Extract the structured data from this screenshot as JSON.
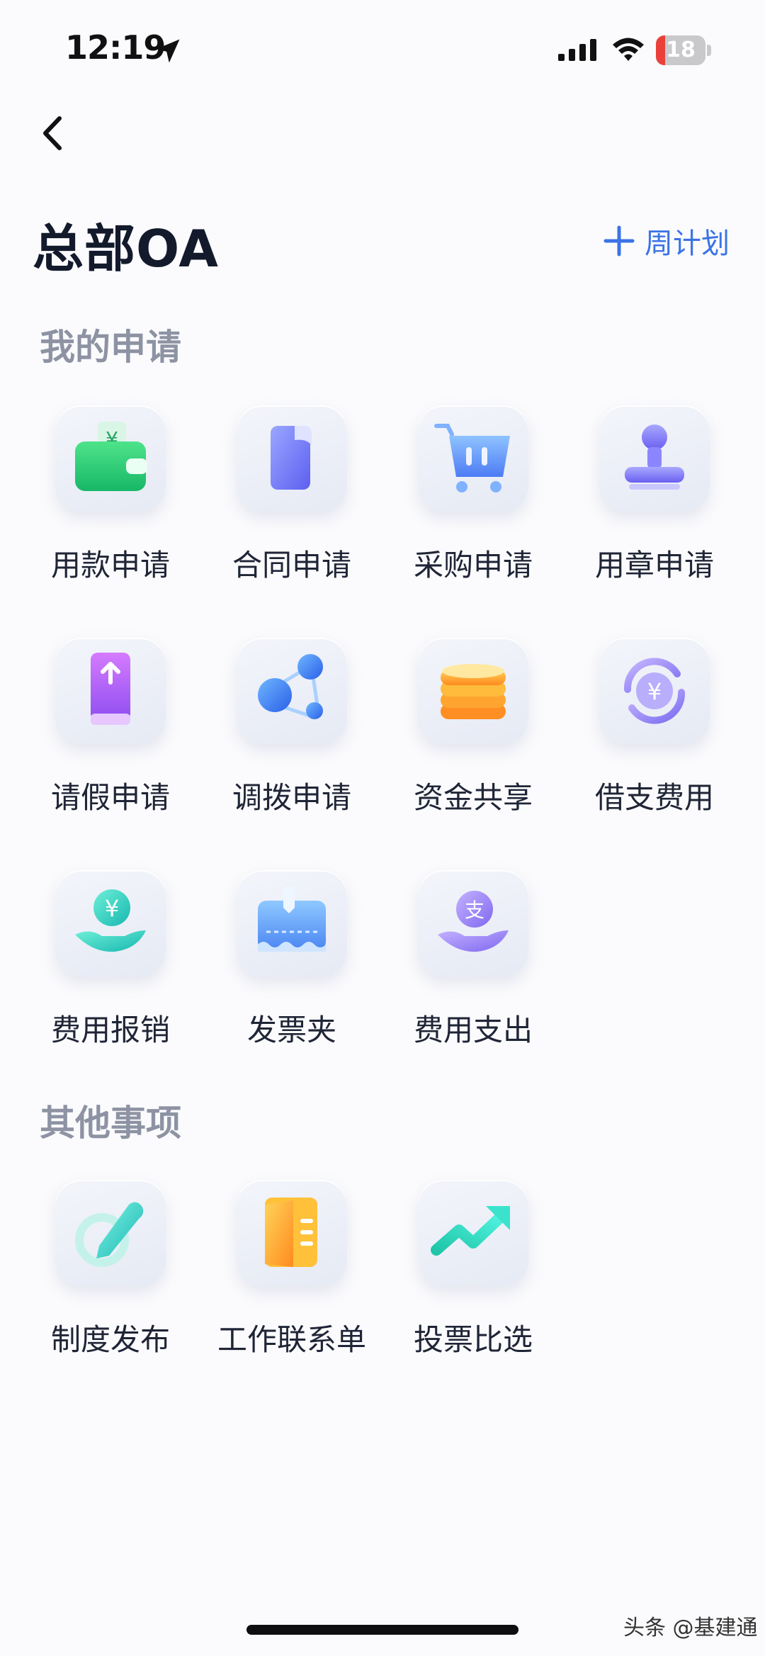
{
  "status_bar": {
    "time": "12:19",
    "battery_level": "18"
  },
  "header": {
    "title": "总部OA",
    "weekly_plan_label": "周计划"
  },
  "sections": [
    {
      "title": "我的申请",
      "items": [
        {
          "label": "用款申请",
          "icon": "wallet-icon"
        },
        {
          "label": "合同申请",
          "icon": "contract-icon"
        },
        {
          "label": "采购申请",
          "icon": "shopping-cart-icon"
        },
        {
          "label": "用章申请",
          "icon": "stamp-icon"
        },
        {
          "label": "请假申请",
          "icon": "leave-icon"
        },
        {
          "label": "调拨申请",
          "icon": "transfer-icon"
        },
        {
          "label": "资金共享",
          "icon": "coins-icon"
        },
        {
          "label": "借支费用",
          "icon": "yuan-exchange-icon"
        },
        {
          "label": "费用报销",
          "icon": "reimbursement-icon"
        },
        {
          "label": "发票夹",
          "icon": "invoice-folder-icon"
        },
        {
          "label": "费用支出",
          "icon": "expense-icon"
        }
      ]
    },
    {
      "title": "其他事项",
      "items": [
        {
          "label": "制度发布",
          "icon": "edit-icon"
        },
        {
          "label": "工作联系单",
          "icon": "folder-icon"
        },
        {
          "label": "投票比选",
          "icon": "trend-icon"
        }
      ]
    }
  ],
  "watermark": "头条 @基建通",
  "colors": {
    "accent": "#3b73e6",
    "battery_low": "#e9413a",
    "section_title": "#8d93a3"
  }
}
